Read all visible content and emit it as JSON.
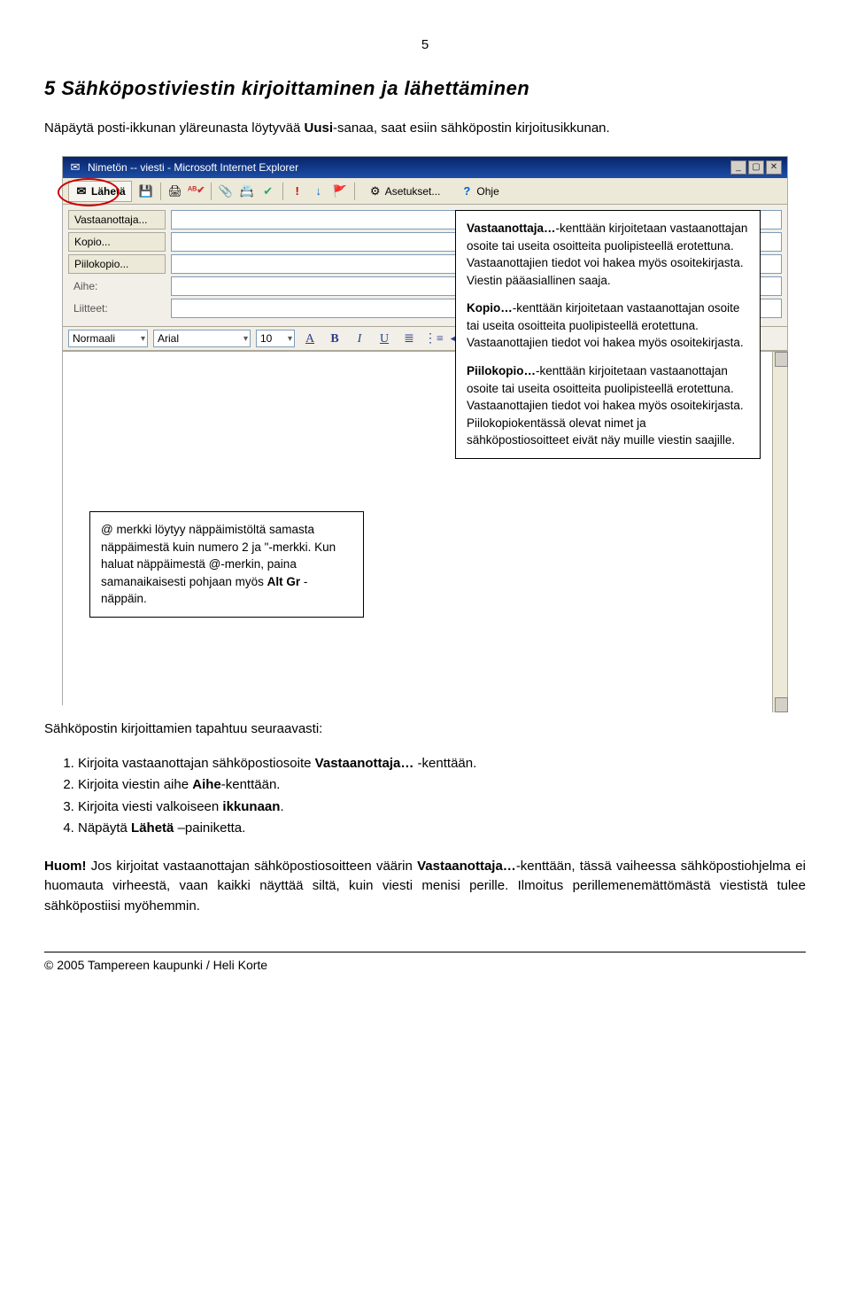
{
  "page_number": "5",
  "heading": "5 Sähköpostiviestin kirjoittaminen ja lähettäminen",
  "intro_pre": "Näpäytä posti-ikkunan yläreunasta löytyvää ",
  "intro_bold": "Uusi",
  "intro_post": "-sanaa, saat esiin sähköpostin kirjoitusikkunan.",
  "screenshot": {
    "title": "Nimetön -- viesti - Microsoft Internet Explorer",
    "toolbar": {
      "send": "Lähetä",
      "settings": "Asetukset...",
      "help": "Ohje"
    },
    "headers": {
      "to": "Vastaanottaja...",
      "cc": "Kopio...",
      "bcc": "Piilokopio...",
      "subject": "Aihe:",
      "attach": "Liitteet:"
    },
    "format": {
      "style": "Normaali",
      "font": "Arial",
      "size": "10"
    }
  },
  "callouts": {
    "to_bold": "Vastaanottaja…",
    "to_text": "-kenttään kirjoitetaan vastaanottajan osoite tai useita osoitteita puolipisteellä erotettuna. Vastaanottajien tiedot voi hakea myös osoitekirjasta. Viestin pääasiallinen saaja.",
    "cc_bold": "Kopio…",
    "cc_text": "-kenttään kirjoitetaan vastaanottajan osoite tai useita osoitteita puolipisteellä erotettuna. Vastaanottajien tiedot voi hakea myös osoitekirjasta.",
    "bcc_bold": "Piilokopio…",
    "bcc_text": "-kenttään kirjoitetaan vastaanottajan osoite tai useita osoitteita puolipisteellä erotettuna. Vastaanottajien tiedot voi hakea myös osoitekirjasta. Piilokopiokentässä olevat nimet ja sähköpostiosoitteet eivät näy muille viestin saajille.",
    "at_pre": "@ merkki löytyy näppäimistöltä samasta näppäimestä kuin numero 2 ja \"-merkki. Kun haluat näppäimestä @-merkin, paina samanaikaisesti pohjaan myös ",
    "at_bold": "Alt Gr",
    "at_post": " -näppäin."
  },
  "after": {
    "lead": "Sähköpostin kirjoittamien tapahtuu seuraavasti:",
    "step1_pre": "Kirjoita vastaanottajan sähköpostiosoite ",
    "step1_bold": "Vastaanottaja…",
    "step1_post": " -kenttään.",
    "step2_pre": "Kirjoita viestin aihe ",
    "step2_bold": "Aihe",
    "step2_post": "-kenttään.",
    "step3_pre": "Kirjoita viesti valkoiseen ",
    "step3_bold": "ikkunaan",
    "step3_post": ".",
    "step4_pre": "Näpäytä ",
    "step4_bold": "Lähetä",
    "step4_post": " –painiketta.",
    "huom_bold1": "Huom!",
    "huom_mid1": " Jos kirjoitat vastaanottajan sähköpostiosoitteen väärin ",
    "huom_bold2": "Vastaanottaja…",
    "huom_post": "-kenttään, tässä vaiheessa sähköpostiohjelma ei huomauta virheestä, vaan kaikki näyttää siltä, kuin viesti menisi perille. Ilmoitus perillemenemättömästä viestistä tulee sähköpostiisi myöhemmin."
  },
  "footer": "© 2005 Tampereen kaupunki / Heli Korte"
}
